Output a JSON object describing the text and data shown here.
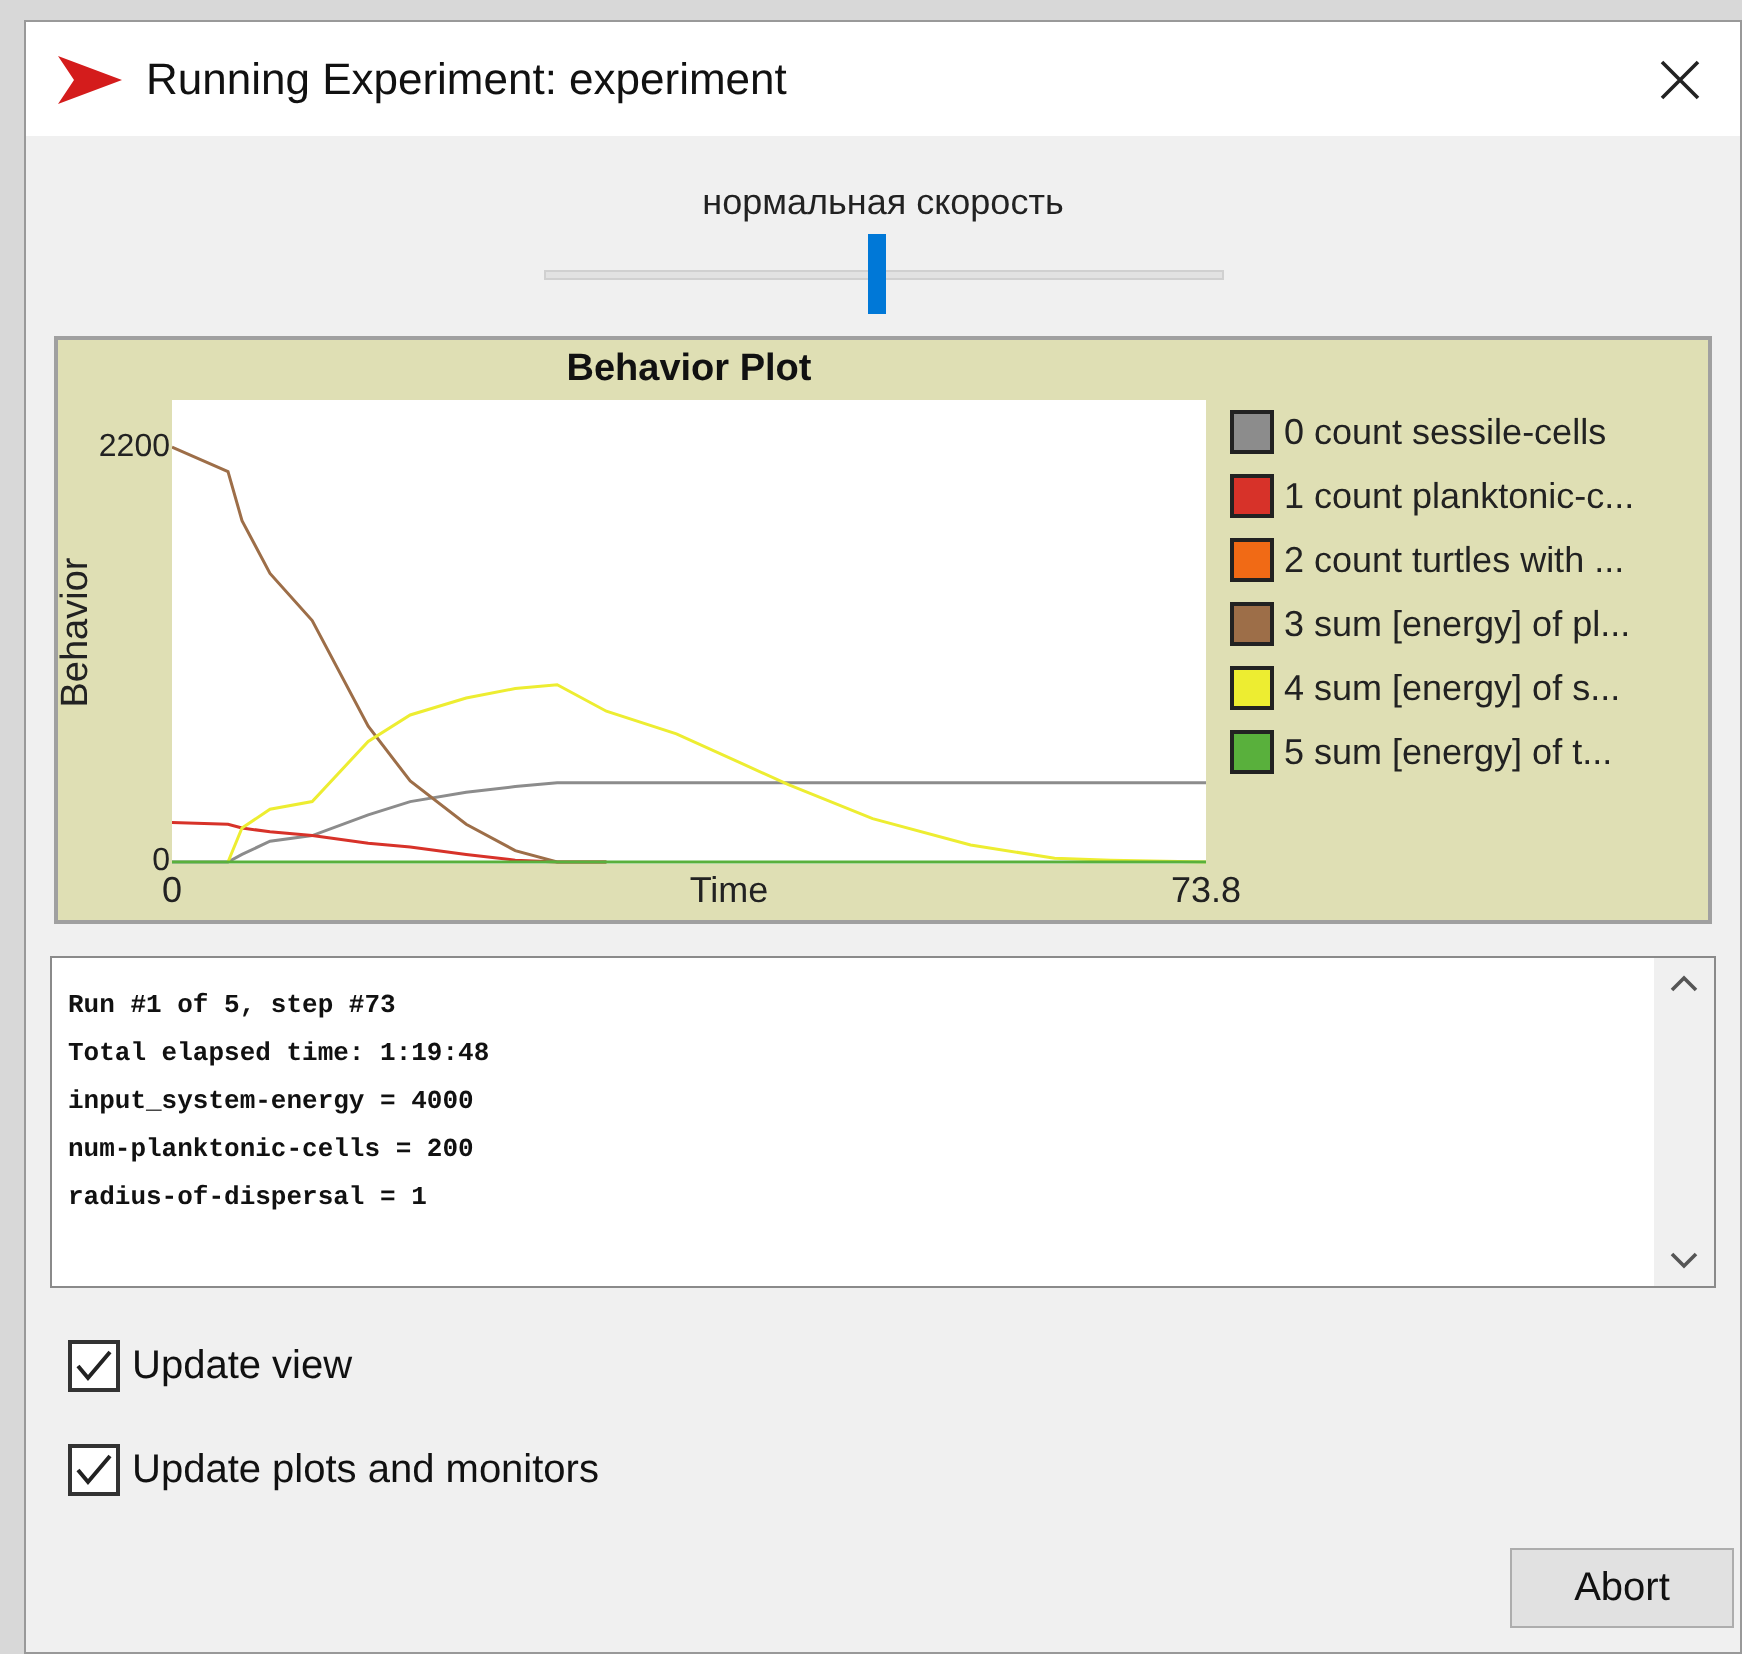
{
  "window": {
    "title": "Running Experiment: experiment"
  },
  "speed_slider": {
    "label": "нормальная скорость",
    "level": 0.49
  },
  "plot": {
    "chart_data": {
      "type": "line",
      "title": "Behavior Plot",
      "xlabel": "Time",
      "ylabel": "Behavior",
      "x": [
        0,
        4,
        5,
        7,
        10,
        14,
        17,
        21,
        24.5,
        27.5,
        31,
        36,
        44,
        50,
        57,
        63,
        67,
        73.8
      ],
      "series": [
        {
          "name": "0 count sessile-cells",
          "color": "#8c8c8c",
          "values": [
            0,
            0,
            40,
            110,
            140,
            250,
            320,
            370,
            400,
            420,
            420,
            420,
            420,
            420,
            420,
            420,
            420,
            420
          ]
        },
        {
          "name": "1 count planktonic-c...",
          "color": "#d73229",
          "values": [
            210,
            200,
            180,
            160,
            140,
            100,
            80,
            40,
            10,
            0,
            0,
            null,
            null,
            null,
            null,
            null,
            null,
            null
          ]
        },
        {
          "name": "2 count turtles with ...",
          "color": "#f16a15",
          "values": [
            null,
            null,
            null,
            null,
            null,
            null,
            null,
            null,
            null,
            null,
            null,
            null,
            null,
            null,
            null,
            null,
            null,
            null
          ]
        },
        {
          "name": "3 sum [energy] of pl...",
          "color": "#9d6e48",
          "values": [
            2200,
            2070,
            1810,
            1530,
            1280,
            720,
            430,
            200,
            60,
            0,
            0,
            null,
            null,
            null,
            null,
            null,
            null,
            null
          ]
        },
        {
          "name": "4 sum [energy] of s...",
          "color": "#eded31",
          "values": [
            null,
            0,
            180,
            280,
            320,
            640,
            780,
            870,
            920,
            940,
            800,
            680,
            410,
            230,
            90,
            20,
            10,
            0
          ]
        },
        {
          "name": "5 sum [energy] of t...",
          "color": "#59b03c",
          "values": [
            0,
            0,
            0,
            0,
            0,
            0,
            0,
            0,
            0,
            0,
            0,
            0,
            0,
            0,
            0,
            0,
            0,
            0
          ]
        }
      ],
      "xlim": [
        0,
        73.8
      ],
      "ylim": [
        0,
        2450
      ],
      "xticks": [
        0,
        73.8
      ],
      "yticks": [
        0,
        2200
      ],
      "legend": "right"
    }
  },
  "output_lines": [
    "Run #1 of 5, step #73",
    "Total elapsed time: 1:19:48",
    "input_system-energy = 4000",
    "num-planktonic-cells = 200",
    "radius-of-dispersal = 1"
  ],
  "checkboxes": [
    {
      "label": "Update view",
      "checked": true
    },
    {
      "label": "Update plots and monitors",
      "checked": true
    }
  ],
  "buttons": [
    {
      "label": "Abort"
    }
  ]
}
